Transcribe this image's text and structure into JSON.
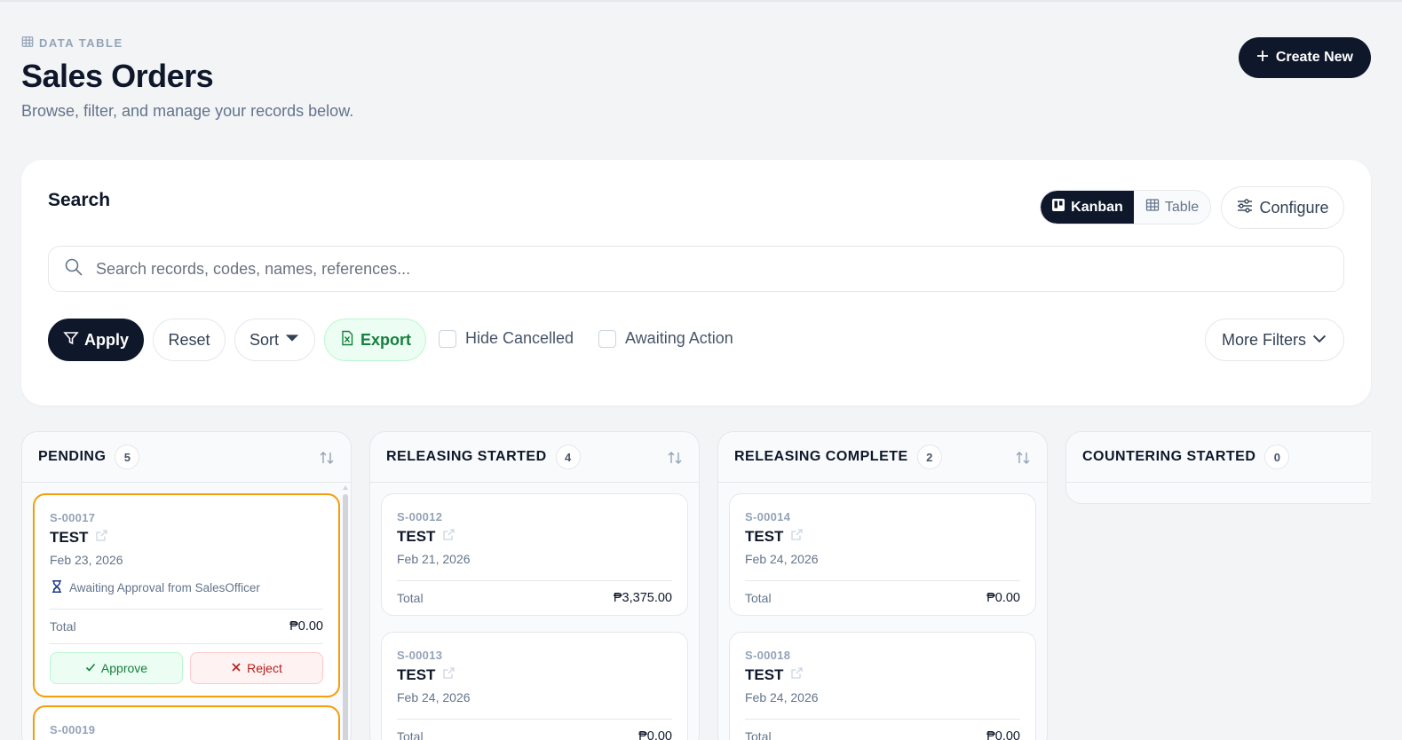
{
  "header": {
    "eyebrow": "DATA TABLE",
    "title": "Sales Orders",
    "subtitle": "Browse, filter, and manage your records below.",
    "create_label": "Create New"
  },
  "search_panel": {
    "title": "Search",
    "view_kanban": "Kanban",
    "view_table": "Table",
    "active_view": "Kanban",
    "configure": "Configure",
    "search_placeholder": "Search records, codes, names, references...",
    "search_value": ""
  },
  "filters": {
    "apply": "Apply",
    "reset": "Reset",
    "sort": "Sort",
    "export": "Export",
    "hide_cancelled": "Hide Cancelled",
    "awaiting_action": "Awaiting Action",
    "more_filters": "More Filters"
  },
  "columns": [
    {
      "title": "PENDING",
      "count": "5",
      "cards": [
        {
          "code": "S-00017",
          "name": "TEST",
          "date": "Feb 23, 2026",
          "awaiting": "Awaiting Approval from SalesOfficer",
          "total_label": "Total",
          "total": "₱0.00",
          "approve": "Approve",
          "reject": "Reject"
        },
        {
          "code": "S-00019"
        }
      ]
    },
    {
      "title": "RELEASING STARTED",
      "count": "4",
      "cards": [
        {
          "code": "S-00012",
          "name": "TEST",
          "date": "Feb 21, 2026",
          "total_label": "Total",
          "total": "₱3,375.00"
        },
        {
          "code": "S-00013",
          "name": "TEST",
          "date": "Feb 24, 2026",
          "total_label": "Total",
          "total": "₱0.00"
        }
      ]
    },
    {
      "title": "RELEASING COMPLETE",
      "count": "2",
      "cards": [
        {
          "code": "S-00014",
          "name": "TEST",
          "date": "Feb 24, 2026",
          "total_label": "Total",
          "total": "₱0.00"
        },
        {
          "code": "S-00018",
          "name": "TEST",
          "date": "Feb 24, 2026",
          "total_label": "Total",
          "total": "₱0.00"
        }
      ]
    },
    {
      "title": "COUNTERING STARTED",
      "count": "0",
      "cards": []
    }
  ],
  "colors": {
    "primary": "#0f172a",
    "background": "#f3f4f6",
    "highlight_border": "#f59e0b",
    "approve_green": "#15803d",
    "reject_red": "#b91c1c"
  }
}
